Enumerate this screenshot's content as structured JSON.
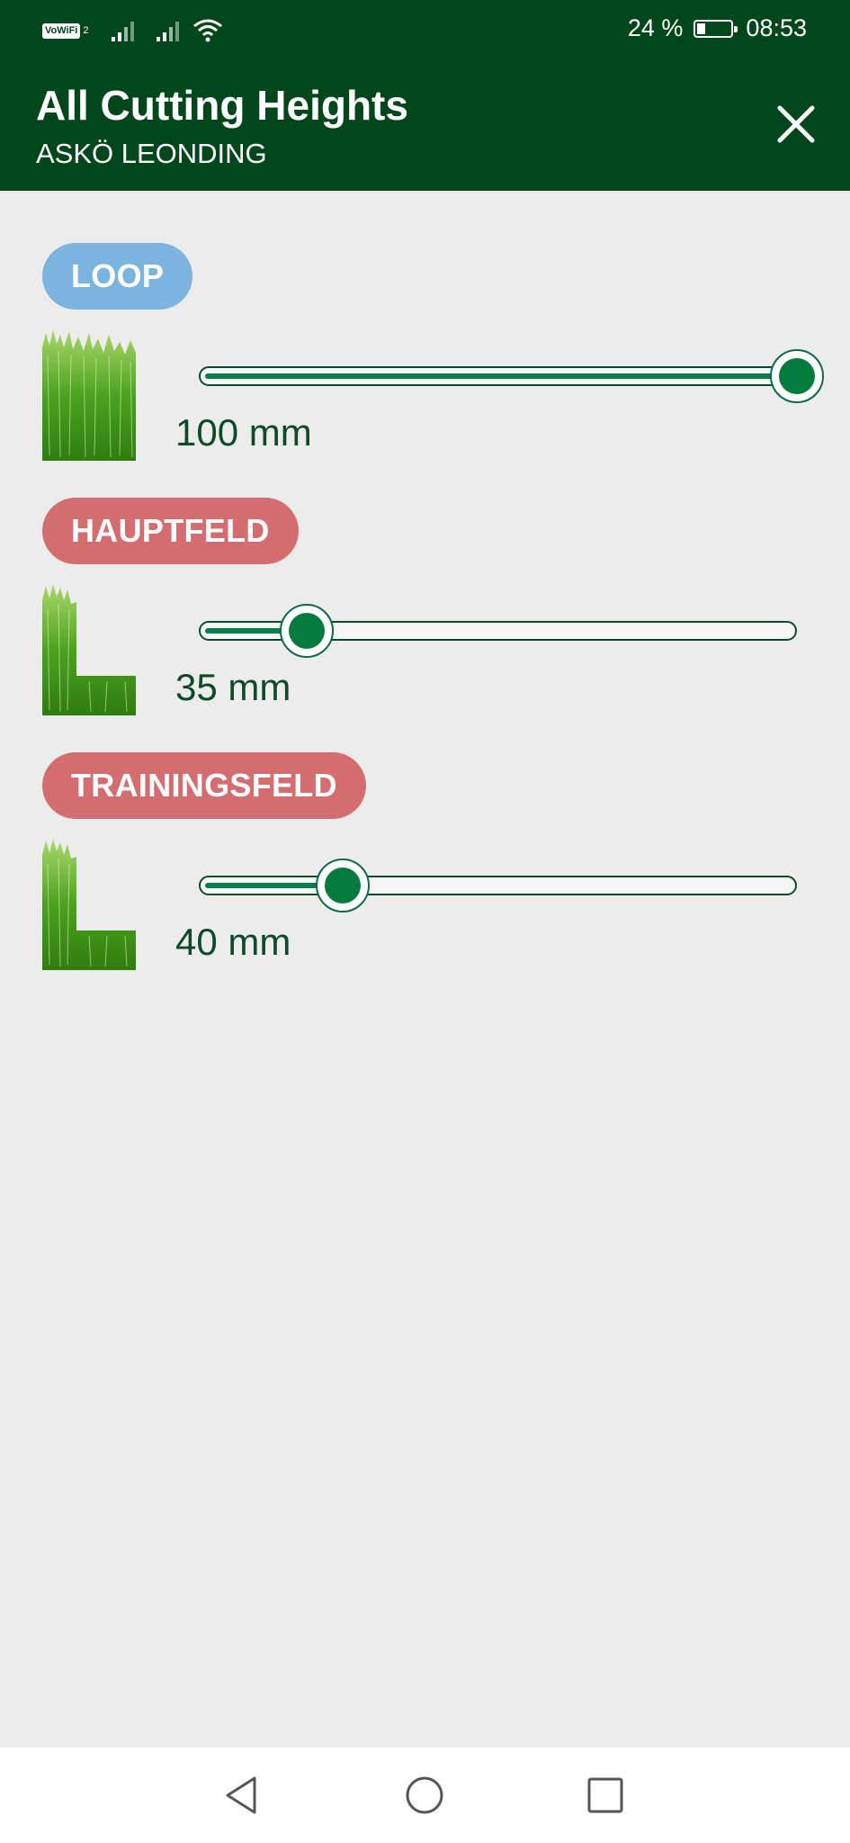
{
  "status_bar": {
    "vowifi_label": "VoWiFi",
    "vowifi_sub": "2",
    "battery_text": "24 %",
    "battery_level": 0.24,
    "time": "08:53"
  },
  "header": {
    "title": "All Cutting Heights",
    "subtitle": "ASKÖ LEONDING",
    "close_icon": "close-icon"
  },
  "fields": [
    {
      "label": "LOOP",
      "label_color": "#7cb4e0",
      "value_text": "100 mm",
      "value_mm": 100,
      "slider_fraction": 1.0,
      "icon": "grass-tall-icon"
    },
    {
      "label": "HAUPTFELD",
      "label_color": "#d36d70",
      "value_text": "35 mm",
      "value_mm": 35,
      "slider_fraction": 0.18,
      "icon": "grass-short-icon"
    },
    {
      "label": "TRAININGSFELD",
      "label_color": "#d36d70",
      "value_text": "40 mm",
      "value_mm": 40,
      "slider_fraction": 0.24,
      "icon": "grass-short-icon"
    }
  ],
  "nav": {
    "back_icon": "back-triangle-icon",
    "home_icon": "home-circle-icon",
    "recents_icon": "recents-square-icon"
  },
  "colors": {
    "primary_dark": "#02461b",
    "background": "#ececec",
    "slider_fill": "#0b7d4d",
    "thumb": "#047a3c"
  }
}
